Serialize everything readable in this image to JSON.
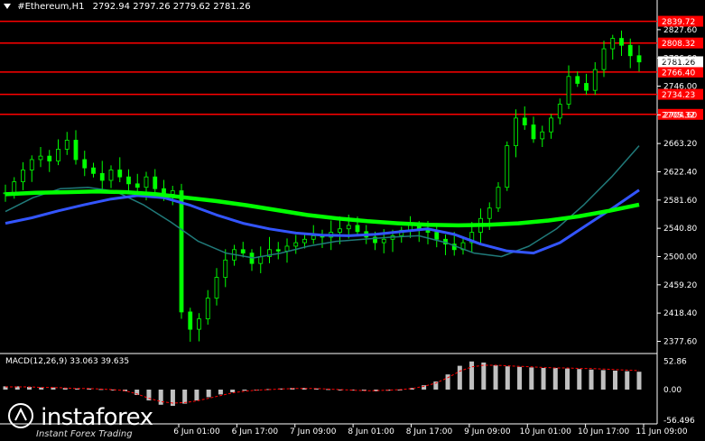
{
  "header": {
    "symbol": "#Ethereum,H1",
    "ohlc": "2792.94 2797.26 2779.62 2781.26"
  },
  "macd": {
    "label": "MACD(12,26,9) 33.063 39.635",
    "axis_labels": [
      "52.86",
      "0.00",
      "-56.496"
    ]
  },
  "price_axis": [
    "2827.60",
    "2786.60",
    "2746.00",
    "2704.60",
    "2663.20",
    "2622.40",
    "2581.60",
    "2540.80",
    "2500.00",
    "2459.20",
    "2418.40",
    "2377.60"
  ],
  "level_lines": [
    {
      "label": "2839.72",
      "price": 2839.72
    },
    {
      "label": "2808.32",
      "price": 2808.32
    },
    {
      "label": "2766.40",
      "price": 2766.4
    },
    {
      "label": "2734.23",
      "price": 2734.23
    },
    {
      "label": "2705.32",
      "price": 2705.32
    }
  ],
  "current_price": "2781.26",
  "time_axis": [
    "6 Jun 01:00",
    "6 Jun 17:00",
    "7 Jun 09:00",
    "8 Jun 01:00",
    "8 Jun 17:00",
    "9 Jun 09:00",
    "10 Jun 01:00",
    "10 Jun 17:00",
    "11 Jun 09:00"
  ],
  "watermark": {
    "brand": "instaforex",
    "tagline": "Instant Forex Trading"
  },
  "colors": {
    "background": "#000000",
    "level": "#ff0000",
    "candle": "#00ff00",
    "ma_fast": "#00ff00",
    "ma_mid": "#3355ff",
    "ma_slow": "#207a7a",
    "macd_hist": "#c0c0c0",
    "macd_signal": "#ff0000"
  },
  "chart_data": {
    "type": "candlestick",
    "title": "#Ethereum,H1",
    "ylim": [
      2360,
      2860
    ],
    "price_path": [
      2592,
      2608,
      2625,
      2640,
      2645,
      2638,
      2655,
      2668,
      2640,
      2628,
      2620,
      2610,
      2625,
      2615,
      2605,
      2600,
      2615,
      2598,
      2590,
      2595,
      2420,
      2395,
      2410,
      2440,
      2470,
      2495,
      2510,
      2505,
      2490,
      2500,
      2510,
      2508,
      2515,
      2520,
      2525,
      2530,
      2528,
      2535,
      2540,
      2545,
      2536,
      2528,
      2520,
      2525,
      2530,
      2538,
      2545,
      2540,
      2535,
      2525,
      2518,
      2510,
      2520,
      2535,
      2555,
      2570,
      2600,
      2660,
      2700,
      2690,
      2670,
      2680,
      2700,
      2720,
      2760,
      2750,
      2740,
      2770,
      2800,
      2815,
      2805,
      2790,
      2781
    ],
    "ma_fast_path": [
      2590,
      2592,
      2593,
      2594,
      2593,
      2590,
      2585,
      2580,
      2574,
      2567,
      2560,
      2555,
      2551,
      2548,
      2546,
      2545,
      2546,
      2548,
      2552,
      2558,
      2566,
      2575
    ],
    "ma_mid_path": [
      2548,
      2556,
      2566,
      2575,
      2583,
      2588,
      2585,
      2574,
      2560,
      2548,
      2540,
      2534,
      2531,
      2530,
      2532,
      2536,
      2540,
      2532,
      2518,
      2508,
      2505,
      2520,
      2545,
      2570,
      2596
    ],
    "ma_slow_path": [
      2565,
      2585,
      2598,
      2600,
      2594,
      2575,
      2550,
      2522,
      2505,
      2498,
      2505,
      2515,
      2522,
      2525,
      2528,
      2530,
      2520,
      2505,
      2500,
      2515,
      2540,
      2575,
      2615,
      2660
    ],
    "macd_hist": [
      6,
      6,
      5,
      4,
      4,
      3,
      2,
      2,
      1,
      0,
      -3,
      -10,
      -20,
      -28,
      -30,
      -26,
      -20,
      -14,
      -9,
      -5,
      -2,
      0,
      1,
      2,
      3,
      3,
      2,
      1,
      0,
      -1,
      -2,
      -3,
      -2,
      0,
      3,
      8,
      15,
      28,
      44,
      52,
      50,
      45,
      43,
      42,
      41,
      40,
      40,
      39,
      38,
      37,
      36,
      35,
      34,
      33
    ],
    "macd_signal": [
      5,
      5,
      5,
      4,
      4,
      3,
      2,
      2,
      1,
      0,
      -2,
      -8,
      -16,
      -22,
      -25,
      -24,
      -21,
      -16,
      -11,
      -6,
      -3,
      -1,
      0,
      1,
      2,
      2,
      2,
      1,
      0,
      -1,
      -2,
      -2,
      -1,
      0,
      2,
      6,
      12,
      22,
      34,
      42,
      45,
      45,
      44,
      43,
      42,
      41,
      40,
      40,
      39,
      39,
      38,
      37,
      36,
      35
    ]
  }
}
